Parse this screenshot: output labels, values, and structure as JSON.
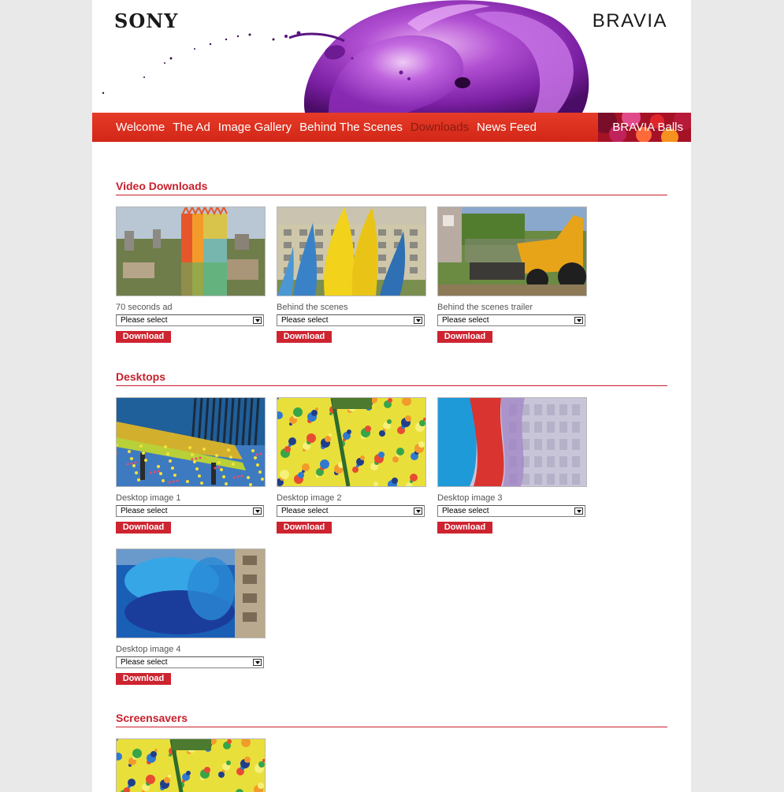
{
  "header": {
    "logo_left": "SONY",
    "logo_right": "BRAVIA"
  },
  "nav": {
    "items": [
      {
        "label": "Welcome",
        "active": false
      },
      {
        "label": "The Ad",
        "active": false
      },
      {
        "label": "Image Gallery",
        "active": false
      },
      {
        "label": "Behind The Scenes",
        "active": false
      },
      {
        "label": "Downloads",
        "active": true
      },
      {
        "label": "News Feed",
        "active": false
      }
    ],
    "promo_label": "BRAVIA Balls"
  },
  "sections": [
    {
      "title": "Video Downloads",
      "items": [
        {
          "label": "70 seconds ad",
          "select": "Please select",
          "button": "Download",
          "thumb": "tower-paint"
        },
        {
          "label": "Behind the scenes",
          "select": "Please select",
          "button": "Download",
          "thumb": "yellow-explosion"
        },
        {
          "label": "Behind the scenes trailer",
          "select": "Please select",
          "button": "Download",
          "thumb": "digger"
        }
      ]
    },
    {
      "title": "Desktops",
      "items": [
        {
          "label": "Desktop image 1",
          "select": "Please select",
          "button": "Download",
          "thumb": "bench"
        },
        {
          "label": "Desktop image 2",
          "select": "Please select",
          "button": "Download",
          "thumb": "swing-splatter"
        },
        {
          "label": "Desktop image 3",
          "select": "Please select",
          "button": "Download",
          "thumb": "red-blue-wall"
        },
        {
          "label": "Desktop image 4",
          "select": "Please select",
          "button": "Download",
          "thumb": "blue-splash"
        }
      ]
    },
    {
      "title": "Screensavers",
      "items": [
        {
          "thumb": "swing-splatter-2"
        }
      ]
    }
  ],
  "colors": {
    "accent": "#c8202c",
    "nav": "#df3422",
    "active_nav": "#8a1c10",
    "page_bg": "#e9e9e9"
  }
}
